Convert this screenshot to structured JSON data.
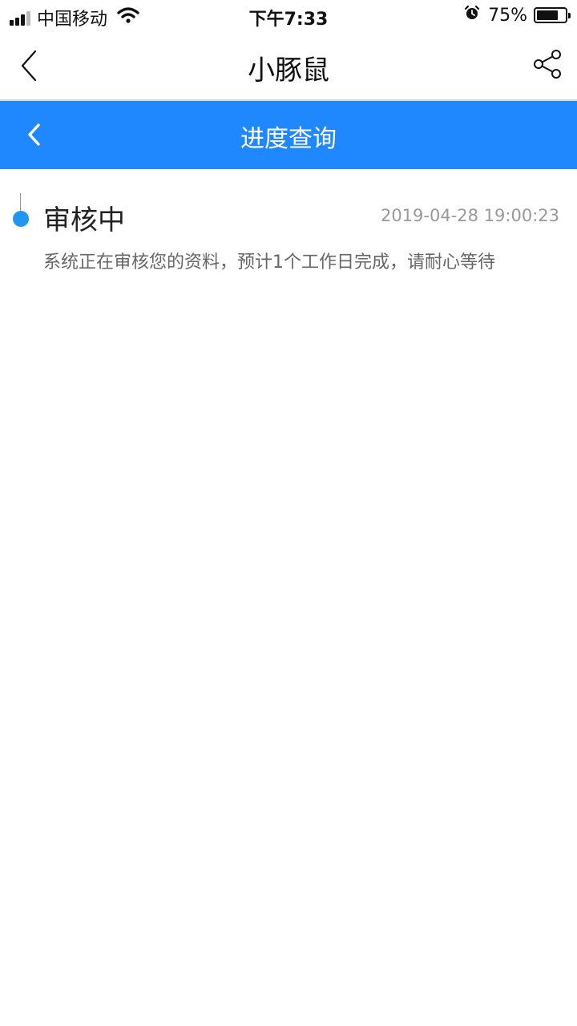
{
  "status_bar": {
    "carrier": "中国移动",
    "time": "下午7:33",
    "battery_percent": "75%",
    "battery_level": 0.75
  },
  "nav": {
    "title": "小豚鼠",
    "back_icon": "chevron-left-icon",
    "share_icon": "share-icon"
  },
  "header": {
    "title": "进度查询",
    "back_icon": "chevron-left-icon",
    "color": "#2088ff"
  },
  "timeline": {
    "items": [
      {
        "status": "审核中",
        "timestamp": "2019-04-28 19:00:23",
        "description": "系统正在审核您的资料，预计1个工作日完成，请耐心等待",
        "dot_color": "#2196f3"
      }
    ]
  }
}
